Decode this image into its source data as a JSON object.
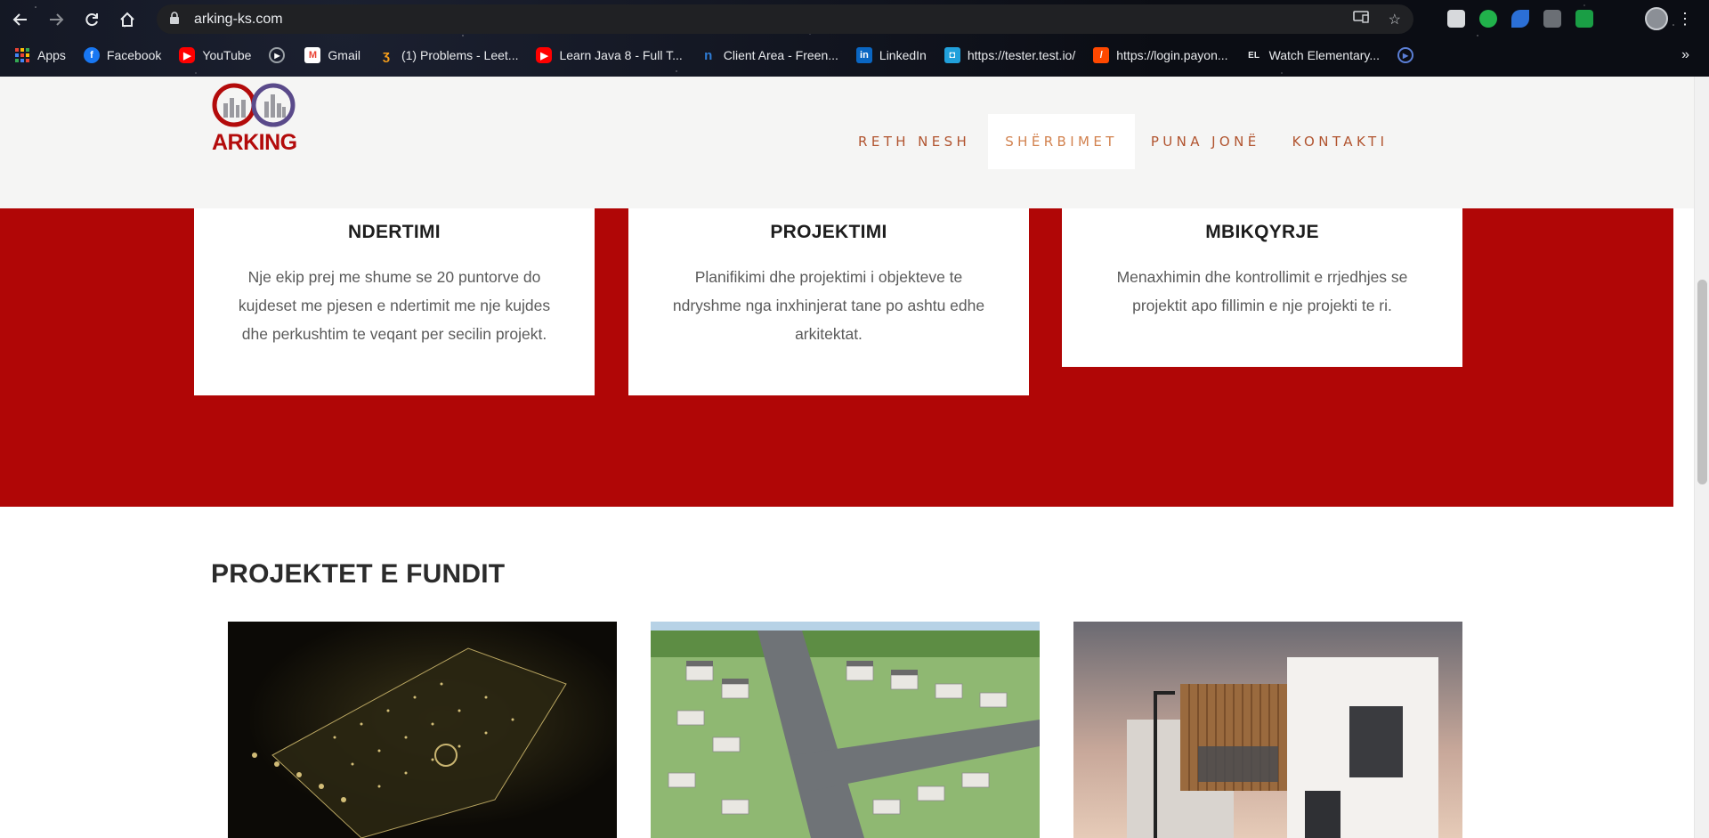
{
  "browser": {
    "url": "arking-ks.com",
    "bookmarks": [
      {
        "label": "Apps",
        "icon": "apps-grid-icon",
        "color": "#ea4335"
      },
      {
        "label": "Facebook",
        "icon": "facebook-icon",
        "color": "#1877f2"
      },
      {
        "label": "YouTube",
        "icon": "youtube-icon",
        "color": "#ff0000"
      },
      {
        "label": "",
        "icon": "play-circle-icon",
        "color": "#9aa0a6"
      },
      {
        "label": "Gmail",
        "icon": "gmail-icon",
        "color": "#ea4335"
      },
      {
        "label": "(1) Problems - Leet...",
        "icon": "leetcode-icon",
        "color": "#f89f1b"
      },
      {
        "label": "Learn Java 8 - Full T...",
        "icon": "youtube-icon",
        "color": "#ff0000"
      },
      {
        "label": "Client Area - Freen...",
        "icon": "freenom-icon",
        "color": "#2e7cd6"
      },
      {
        "label": "LinkedIn",
        "icon": "linkedin-icon",
        "color": "#0a66c2"
      },
      {
        "label": "https://tester.test.io/",
        "icon": "testio-icon",
        "color": "#21a0db"
      },
      {
        "label": "https://login.payon...",
        "icon": "payoneer-icon",
        "color": "#ff4800"
      },
      {
        "label": "Watch Elementary...",
        "icon": "el-icon",
        "color": "#444444"
      }
    ]
  },
  "header": {
    "logo_text": "ARKING",
    "nav": [
      {
        "label": "RETH NESH",
        "active": false
      },
      {
        "label": "SHËRBIMET",
        "active": true
      },
      {
        "label": "PUNA JONË",
        "active": false
      },
      {
        "label": "KONTAKTI",
        "active": false
      }
    ]
  },
  "services": [
    {
      "title": "NDERTIMI",
      "text": "Nje ekip prej me shume se 20 puntorve do kujdeset me pjesen e ndertimit me nje kujdes dhe perkushtim te veqant per secilin projekt."
    },
    {
      "title": "PROJEKTIMI",
      "text": "Planifikimi dhe projektimi i objekteve te ndryshme nga inxhinjerat tane po ashtu edhe arkitektat."
    },
    {
      "title": "MBIKQYRJE",
      "text": "Menaxhimin dhe kontrollimit e rrjedhjes se projektit apo fillimin e nje projekti te ri."
    }
  ],
  "projects_section": {
    "title": "PROJEKTET E FUNDIT",
    "images": [
      "night-aerial-settlement-image",
      "aerial-housing-development-image",
      "modern-house-render-image"
    ]
  },
  "colors": {
    "brand_red": "#b00606",
    "nav_text": "#b1542f",
    "nav_active": "#d2824f"
  }
}
